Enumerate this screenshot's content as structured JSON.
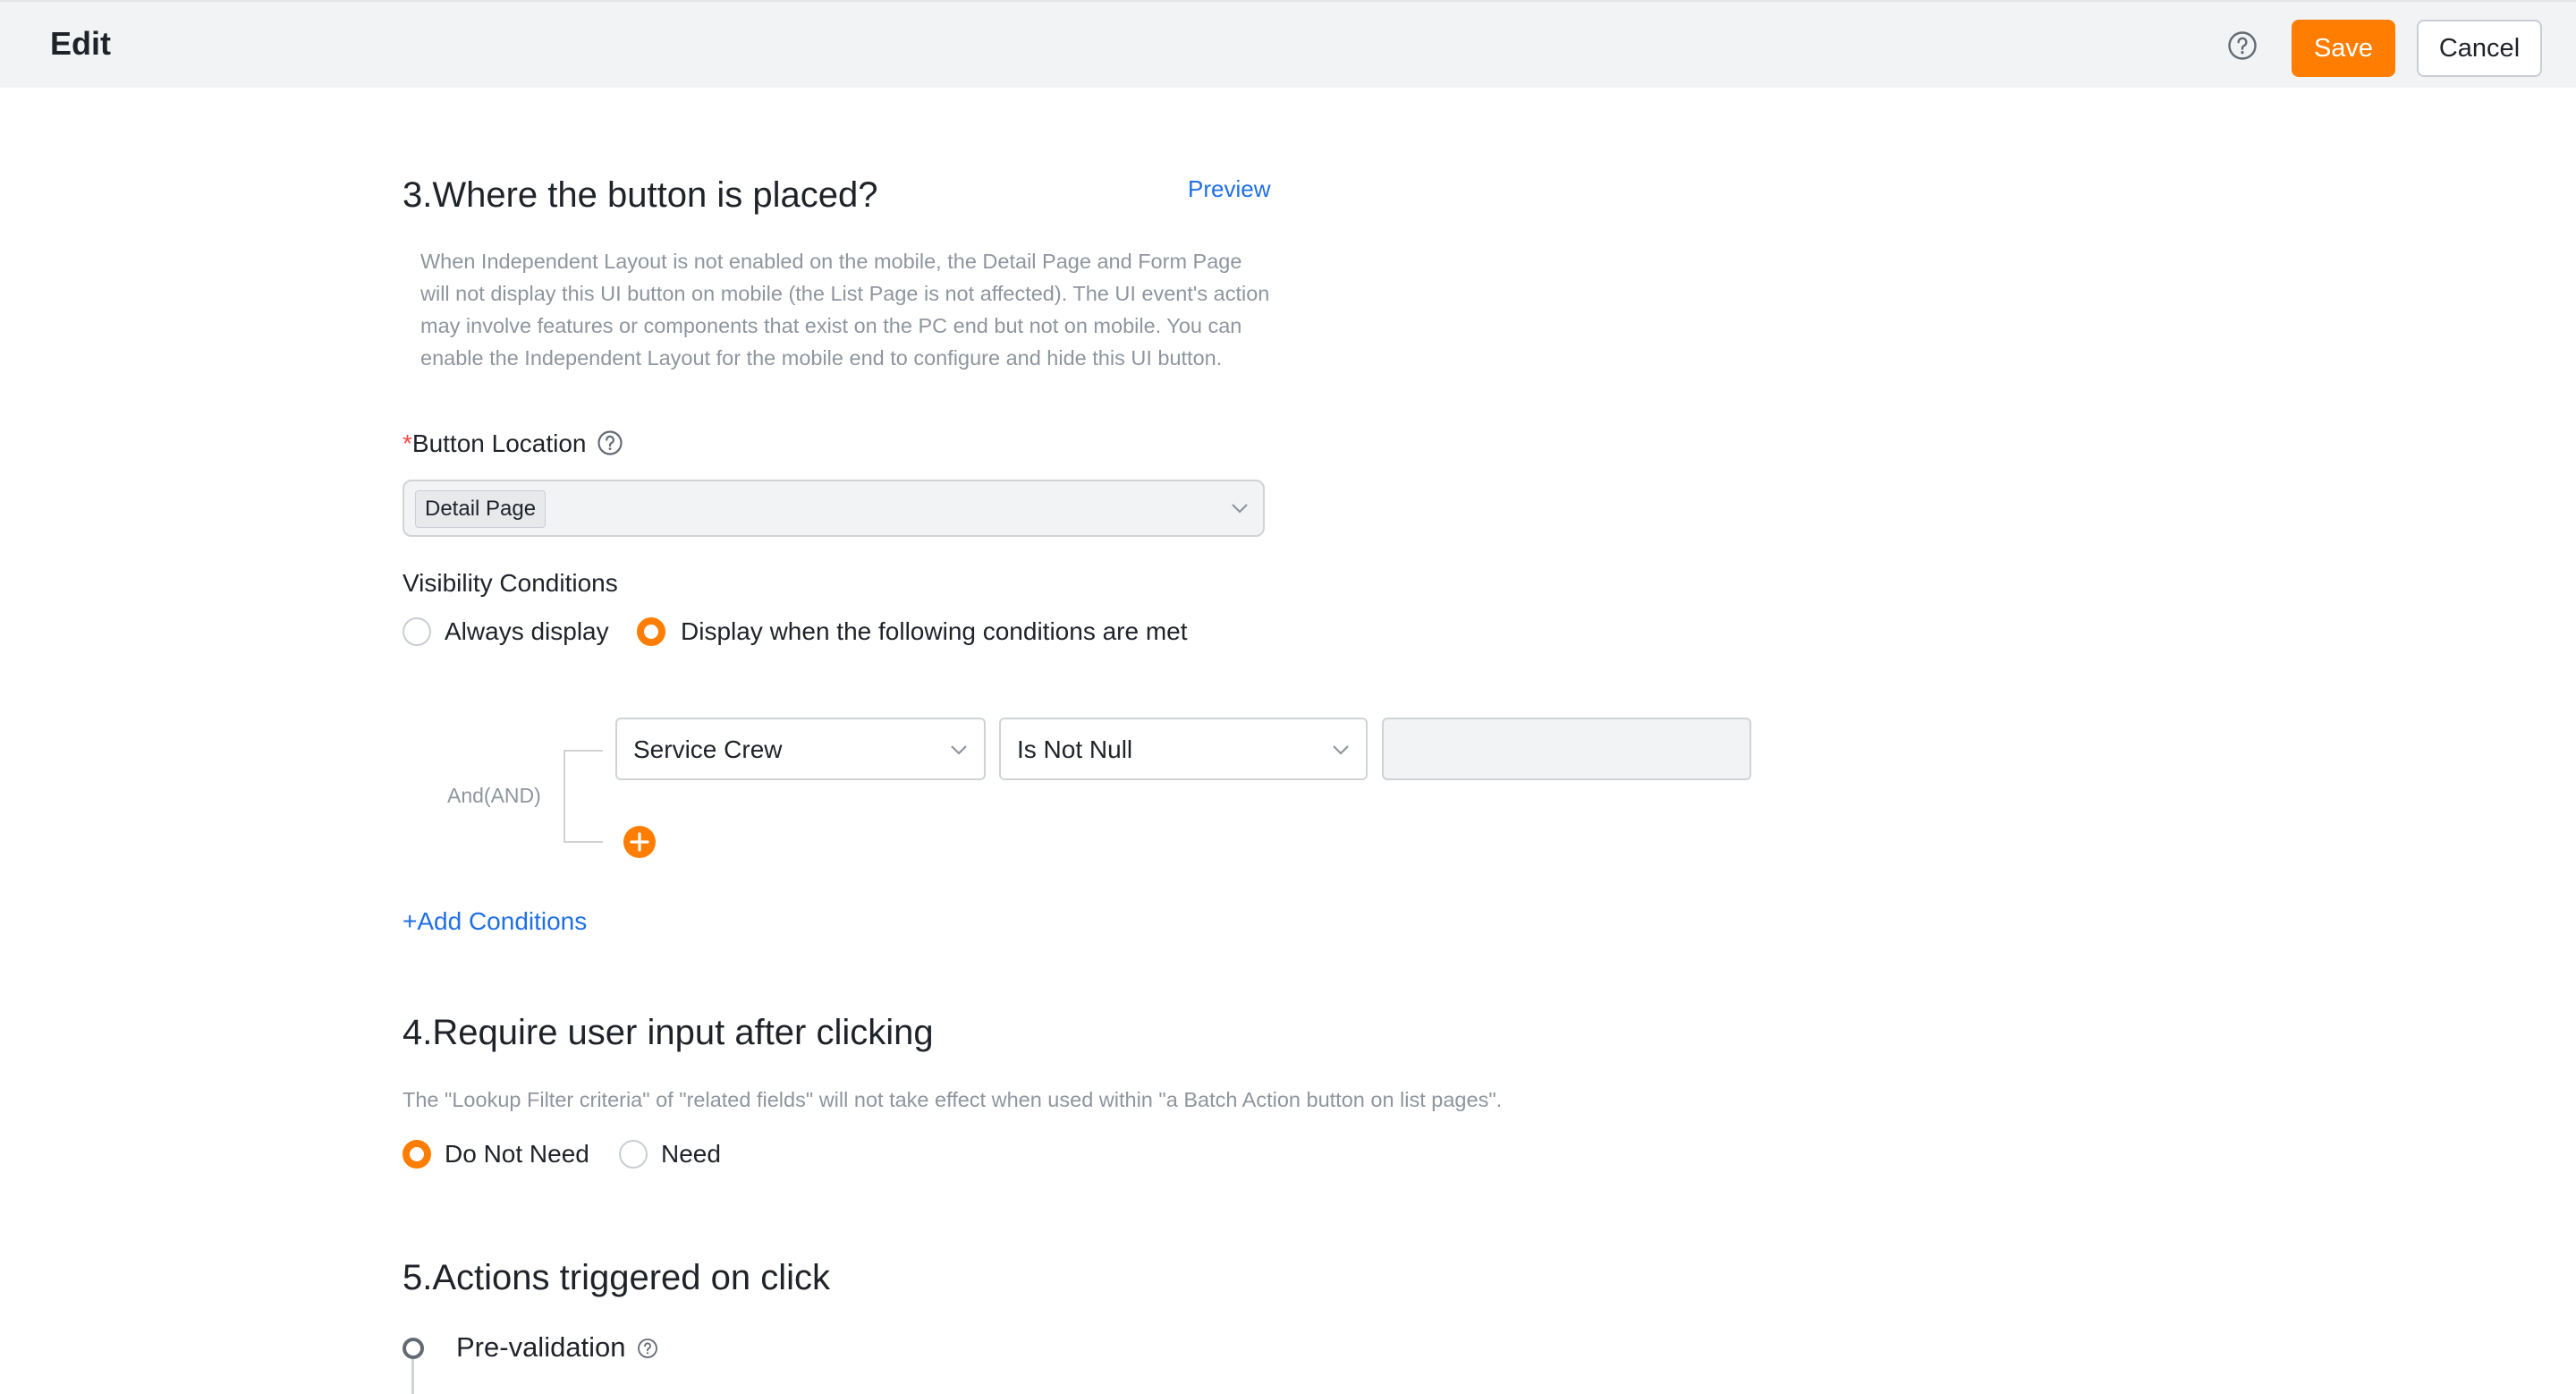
{
  "header": {
    "title": "Edit",
    "help_icon": "question-circle-icon",
    "save_label": "Save",
    "cancel_label": "Cancel"
  },
  "colors": {
    "accent": "#ff7d00",
    "link": "#1f6fe5",
    "header_bg": "#f2f3f5"
  },
  "section3": {
    "title": "3.Where the button is placed?",
    "preview_label": "Preview",
    "notice": "When Independent Layout is not enabled on the mobile, the Detail Page and Form Page will not display this UI button on mobile (the List Page is not affected). The UI event's action may involve features or components that exist on the PC end but not on mobile. You can enable the Independent Layout for the mobile end to configure and hide this UI button.",
    "button_location": {
      "required_mark": "*",
      "label": "Button Location",
      "selected_tags": [
        "Detail Page"
      ]
    },
    "visibility": {
      "label": "Visibility Conditions",
      "options": [
        {
          "label": "Always display",
          "checked": false
        },
        {
          "label": "Display when the following conditions are met",
          "checked": true
        }
      ]
    },
    "conditions": {
      "logic_label": "And(AND)",
      "rows": [
        {
          "field": "Service Crew",
          "operator": "Is Not Null",
          "value": ""
        }
      ],
      "add_conditions_label": "+Add Conditions"
    }
  },
  "section4": {
    "title": "4.Require user input after clicking",
    "hint": "The \"Lookup Filter criteria\" of \"related fields\" will not take effect when used within \"a Batch Action button on list pages\".",
    "options": [
      {
        "label": "Do Not Need",
        "checked": true
      },
      {
        "label": "Need",
        "checked": false
      }
    ]
  },
  "section5": {
    "title": "5.Actions triggered on click",
    "steps": [
      {
        "label": "Pre-validation"
      }
    ]
  }
}
